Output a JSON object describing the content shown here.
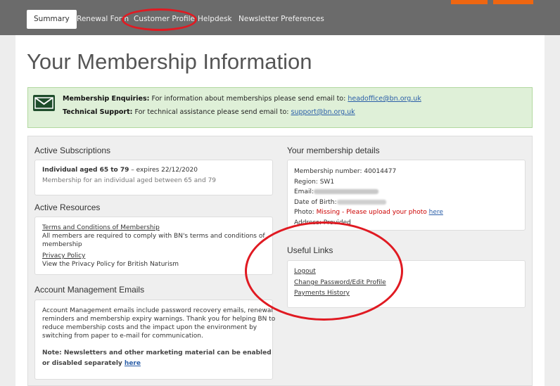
{
  "nav": {
    "tabs": [
      "Summary",
      "Renewal Form",
      "Customer Profile",
      "Helpdesk",
      "Newsletter Preferences"
    ]
  },
  "page": {
    "title": "Your Membership Information"
  },
  "alert": {
    "enquiries_label": "Membership Enquiries:",
    "enquiries_text": "For information about memberships please send email to:",
    "enquiries_email": "headoffice@bn.org.uk",
    "support_label": "Technical Support:",
    "support_text": "For technical assistance please send email to:",
    "support_email": "support@bn.org.uk"
  },
  "subscriptions": {
    "heading": "Active Subscriptions",
    "name": "Individual aged 65 to 79",
    "expires": " – expires 22/12/2020",
    "description": "Membership for an individual aged between 65 and 79"
  },
  "resources": {
    "heading": "Active Resources",
    "terms_link": "Terms and Conditions of Membership",
    "terms_text_1": "All members are required to comply with BN's terms and conditions of",
    "terms_text_2": "membership",
    "privacy_link": "Privacy Policy",
    "privacy_text": "View the Privacy Policy for British Naturism"
  },
  "emails": {
    "heading": "Account Management Emails",
    "line1": "Account Management emails include password recovery emails, renewal",
    "line2": "reminders and membership expiry warnings. Thank you for helping BN to",
    "line3": "reduce membership costs and the impact upon the environment by",
    "line4": "switching from paper to e-mail for communication.",
    "note_line1": "Note: Newsletters and other marketing material can be enabled",
    "note_line2": "or disabled separately ",
    "note_link": "here"
  },
  "details": {
    "heading": "Your membership details",
    "number_label": "Membership number: ",
    "number": "40014477",
    "region_label": "Region: ",
    "region": "SW1",
    "email_label": "Email:",
    "dob_label": "Date of Birth:",
    "photo_label": "Photo: ",
    "photo_missing": "Missing - Please upload your photo ",
    "photo_link": "here",
    "address_label": "Address: ",
    "address": "Provided"
  },
  "useful_links": {
    "heading": "Useful Links",
    "logout": "Logout",
    "change_password": "Change Password/Edit Profile",
    "payments": "Payments History"
  },
  "colors": {
    "topbar": "#6b6b6b",
    "accent_orange": "#ee6611",
    "alert_bg": "#dff0d8",
    "link": "#2a5ea8",
    "annotation_red": "#e01a22"
  }
}
